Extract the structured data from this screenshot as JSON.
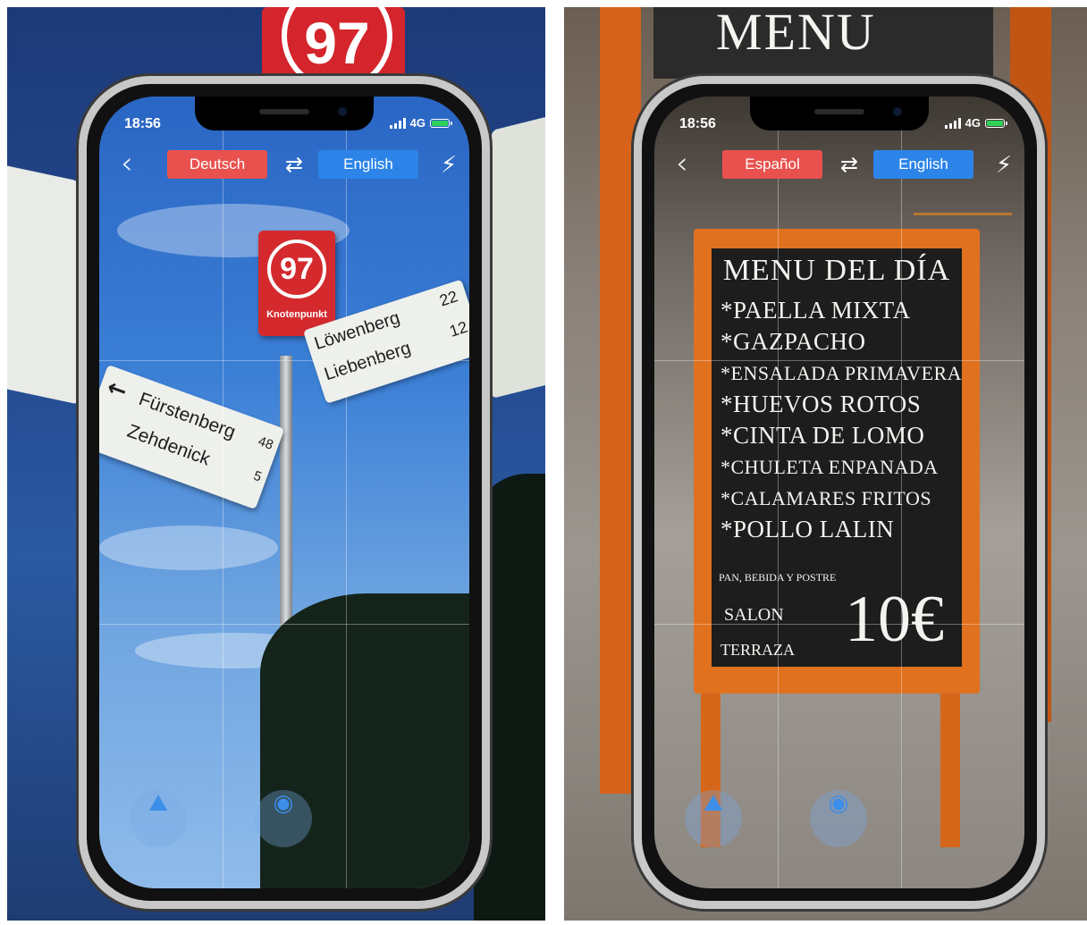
{
  "left_screen": {
    "status": {
      "time": "18:56",
      "network": "4G"
    },
    "toolbar": {
      "source_language": "Deutsch",
      "target_language": "English"
    },
    "scene": {
      "route_sign_number": "97",
      "route_sign_label": "Knotenpunkt",
      "sign_right_line1": "Löwenberg",
      "sign_right_line2": "Liebenberg",
      "sign_right_km1": "22",
      "sign_right_km2": "12",
      "sign_left_line1": "Fürstenberg",
      "sign_left_line2": "Zehdenick",
      "sign_left_km1": "48",
      "sign_left_km2": "5"
    }
  },
  "right_screen": {
    "status": {
      "time": "18:56",
      "network": "4G"
    },
    "toolbar": {
      "source_language": "Español",
      "target_language": "English"
    },
    "scene": {
      "board_title": "MENU DEL DÍA",
      "menu_items": [
        "*PAELLA MIXTA",
        "*GAZPACHO",
        "*ENSALADA PRIMAVERA",
        "*HUEVOS ROTOS",
        "*CINTA DE LOMO",
        "*CHULETA ENPANADA",
        "*CALAMARES FRITOS",
        "*POLLO LALIN"
      ],
      "note": "PAN, BEBIDA Y POSTRE",
      "seating_line1": "SALON",
      "seating_line2": "TERRAZA",
      "price": "10€"
    }
  },
  "background": {
    "left_sign_number": "97",
    "right_board_text": "MENU DEL DIA"
  },
  "icons": {
    "back": "chevron-left-icon",
    "swap": "swap-arrows-icon",
    "flash": "flash-icon",
    "gallery": "gallery-icon",
    "camera": "camera-icon"
  },
  "colors": {
    "source_language_button": "#e8514d",
    "target_language_button": "#2c84e8",
    "battery": "#2fd158"
  }
}
